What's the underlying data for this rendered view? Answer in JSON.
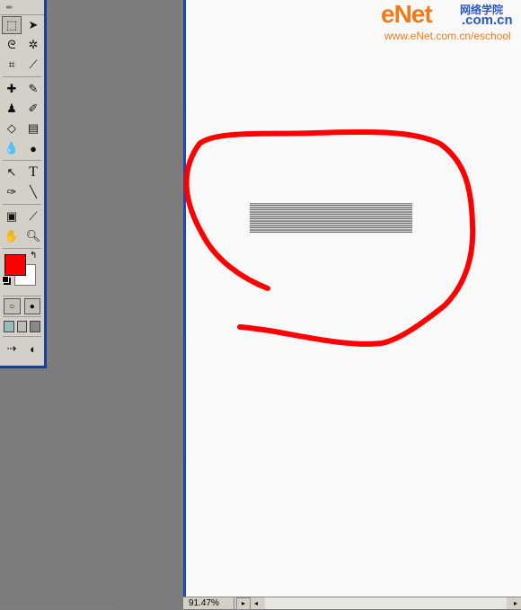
{
  "watermark": {
    "logo_e": "e",
    "logo_net": "Net",
    "logo_cn": "网络学院",
    "logo_site": ".com.cn",
    "url": "www.eNet.com.cn/eschool"
  },
  "toolbox": {
    "foreground_color": "#ff0000",
    "background_color": "#ffffff",
    "tools": [
      "marquee-icon",
      "move-icon",
      "lasso-icon",
      "magic-wand-icon",
      "crop-icon",
      "slice-icon",
      "healing-brush-icon",
      "brush-icon",
      "stamp-icon",
      "history-brush-icon",
      "eraser-icon",
      "gradient-icon",
      "blur-icon",
      "dodge-icon",
      "path-select-icon",
      "type-icon",
      "pen-icon",
      "line-icon",
      "notes-icon",
      "eyedropper-icon",
      "hand-icon",
      "zoom-icon"
    ]
  },
  "status": {
    "zoom": "91.47%"
  },
  "colors": {
    "annotation": "#ff0000",
    "frame": "#1e48b0",
    "watermark_orange": "#f07a18",
    "watermark_blue": "#2a57c2"
  }
}
